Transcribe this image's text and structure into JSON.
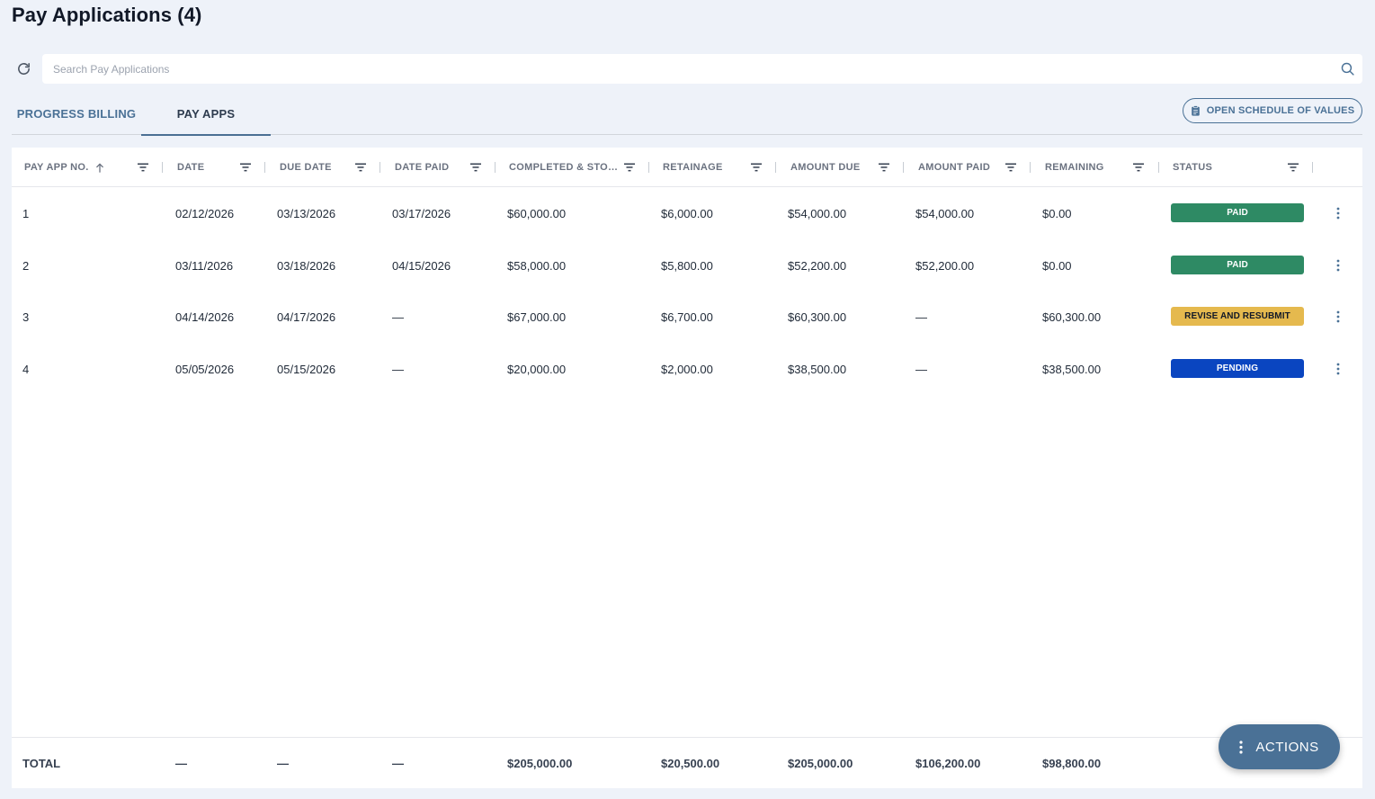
{
  "page": {
    "title": "Pay Applications (4)"
  },
  "search": {
    "placeholder": "Search Pay Applications",
    "value": ""
  },
  "tabs": [
    {
      "label": "PROGRESS BILLING",
      "active": false
    },
    {
      "label": "PAY APPS",
      "active": true
    }
  ],
  "toolbar": {
    "open_sov_label": "OPEN SCHEDULE OF VALUES"
  },
  "table": {
    "columns": [
      {
        "label": "PAY APP NO.",
        "sort": "ascending"
      },
      {
        "label": "DATE"
      },
      {
        "label": "DUE DATE"
      },
      {
        "label": "DATE PAID"
      },
      {
        "label": "COMPLETED & STOR..."
      },
      {
        "label": "RETAINAGE"
      },
      {
        "label": "AMOUNT DUE"
      },
      {
        "label": "AMOUNT PAID"
      },
      {
        "label": "REMAINING"
      },
      {
        "label": "STATUS"
      }
    ],
    "rows": [
      {
        "no": "1",
        "date": "02/12/2026",
        "due_date": "03/13/2026",
        "date_paid": "03/17/2026",
        "completed": "$60,000.00",
        "retainage": "$6,000.00",
        "amount_due": "$54,000.00",
        "amount_paid": "$54,000.00",
        "remaining": "$0.00",
        "status": "PAID",
        "status_color": "#2e8a64",
        "status_text_color": "#ffffff"
      },
      {
        "no": "2",
        "date": "03/11/2026",
        "due_date": "03/18/2026",
        "date_paid": "04/15/2026",
        "completed": "$58,000.00",
        "retainage": "$5,800.00",
        "amount_due": "$52,200.00",
        "amount_paid": "$52,200.00",
        "remaining": "$0.00",
        "status": "PAID",
        "status_color": "#2e8a64",
        "status_text_color": "#ffffff"
      },
      {
        "no": "3",
        "date": "04/14/2026",
        "due_date": "04/17/2026",
        "date_paid": "—",
        "completed": "$67,000.00",
        "retainage": "$6,700.00",
        "amount_due": "$60,300.00",
        "amount_paid": "—",
        "remaining": "$60,300.00",
        "status": "REVISE AND RESUBMIT",
        "status_color": "#e5b94e",
        "status_text_color": "#111827"
      },
      {
        "no": "4",
        "date": "05/05/2026",
        "due_date": "05/15/2026",
        "date_paid": "—",
        "completed": "$20,000.00",
        "retainage": "$2,000.00",
        "amount_due": "$38,500.00",
        "amount_paid": "—",
        "remaining": "$38,500.00",
        "status": "PENDING",
        "status_color": "#0a45c0",
        "status_text_color": "#ffffff"
      }
    ],
    "totals": {
      "label": "TOTAL",
      "date": "—",
      "due_date": "—",
      "date_paid": "—",
      "completed": "$205,000.00",
      "retainage": "$20,500.00",
      "amount_due": "$205,000.00",
      "amount_paid": "$106,200.00",
      "remaining": "$98,800.00"
    }
  },
  "actions": {
    "label": "ACTIONS"
  },
  "colors": {
    "background": "#eef2f9",
    "accent": "#4a7196",
    "paid": "#2e8a64",
    "revise": "#e5b94e",
    "pending": "#0a45c0"
  },
  "icons": {
    "refresh": "refresh-icon",
    "search": "search-icon",
    "clipboard": "clipboard-icon",
    "filter": "filter-icon",
    "sort": "arrow-up-icon",
    "more": "more-vertical-icon"
  }
}
